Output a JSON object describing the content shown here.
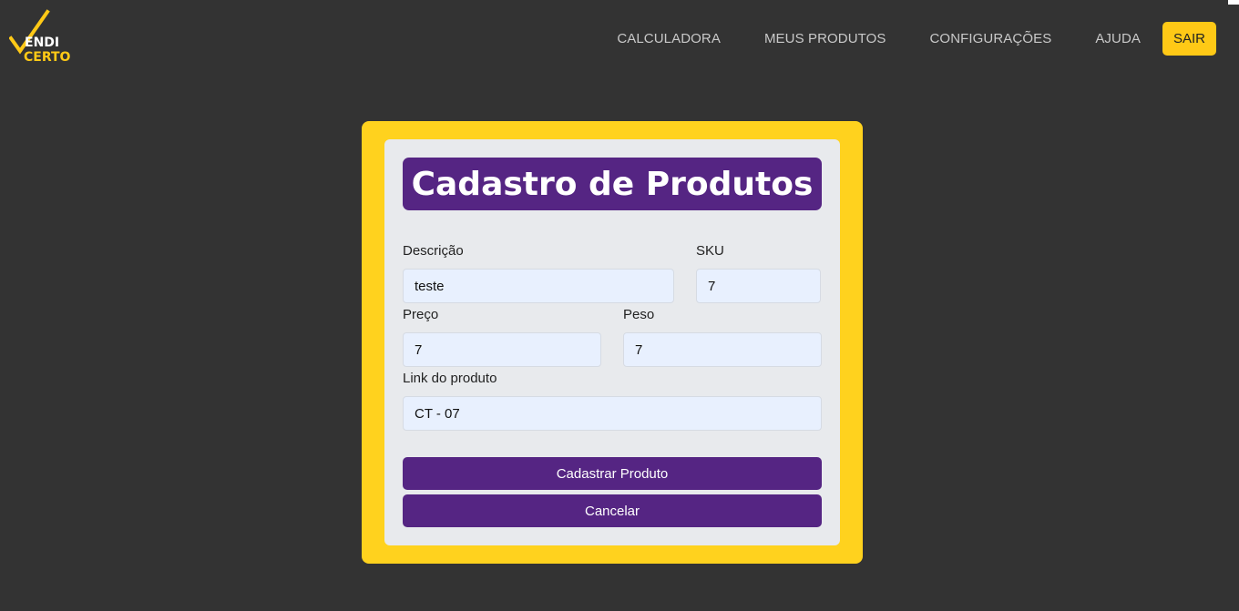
{
  "logo": {
    "line1": "VENDI",
    "line1_rest": "ENDI",
    "line2": "CERTO",
    "icon": "checkmark-icon",
    "colors": {
      "check": "#ffc916",
      "text_top": "#ffffff",
      "text_bottom": "#ffc916"
    }
  },
  "nav": {
    "items": [
      {
        "label": "CALCULADORA"
      },
      {
        "label": "MEUS PRODUTOS"
      },
      {
        "label": "CONFIGURAÇÕES"
      },
      {
        "label": "AJUDA"
      }
    ],
    "logout_label": "SAIR"
  },
  "form": {
    "title": "Cadastro de Produtos",
    "fields": {
      "descricao": {
        "label": "Descrição",
        "value": "teste"
      },
      "sku": {
        "label": "SKU",
        "value": "7"
      },
      "preco": {
        "label": "Preço",
        "value": "7"
      },
      "peso": {
        "label": "Peso",
        "value": "7"
      },
      "link": {
        "label": "Link do produto",
        "value": "CT - 07"
      }
    },
    "submit_label": "Cadastrar Produto",
    "cancel_label": "Cancelar"
  },
  "colors": {
    "background": "#333333",
    "accent_yellow": "#ffd21e",
    "brand_purple": "#552583",
    "panel": "#e8eaed",
    "input_fill": "#e8f0fe"
  }
}
